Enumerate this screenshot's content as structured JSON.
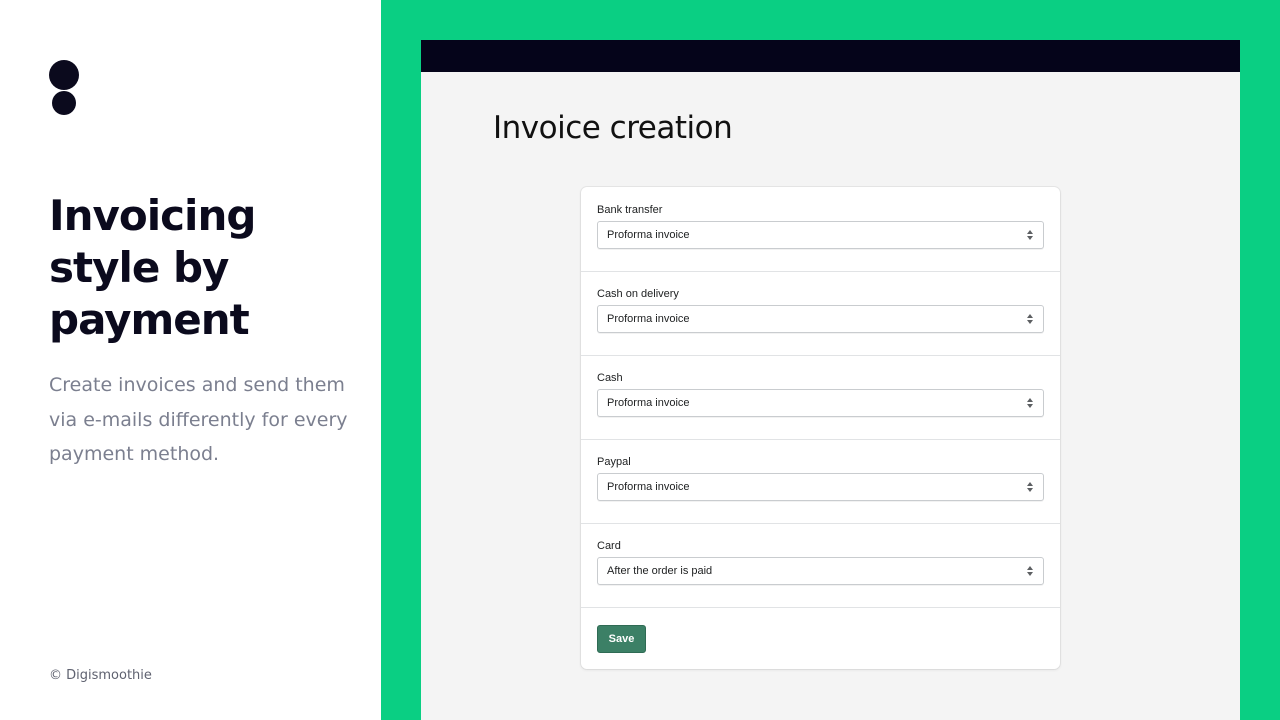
{
  "promo": {
    "headline": "Invoicing style by payment",
    "subtitle": "Create invoices and send them via e-mails differently for every payment method.",
    "copyright": "© Digismoothie"
  },
  "app": {
    "page_title": "Invoice creation",
    "sections": [
      {
        "label": "Bank transfer",
        "value": "Proforma invoice"
      },
      {
        "label": "Cash on delivery",
        "value": "Proforma invoice"
      },
      {
        "label": "Cash",
        "value": "Proforma invoice"
      },
      {
        "label": "Paypal",
        "value": "Proforma invoice"
      },
      {
        "label": "Card",
        "value": "After the order is paid"
      }
    ],
    "save_label": "Save"
  },
  "colors": {
    "brand_green": "#0acf83",
    "dark_navy": "#05041a",
    "save_button": "#3c8066"
  }
}
